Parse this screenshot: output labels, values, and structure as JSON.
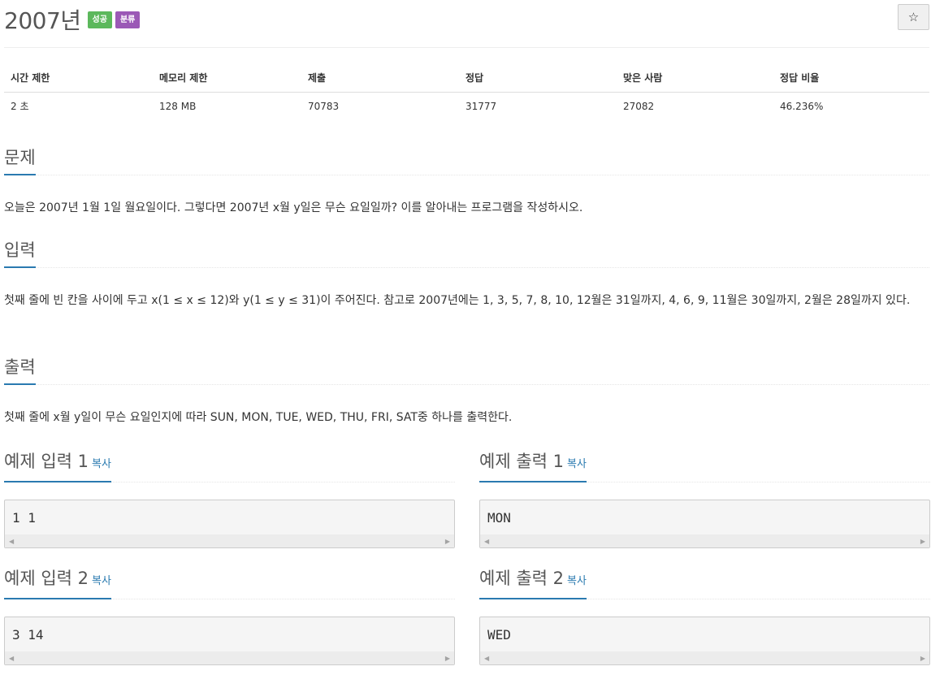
{
  "problem": {
    "title": "2007년",
    "badges": {
      "success": "성공",
      "category": "분류"
    },
    "star_icon": "☆"
  },
  "info_table": {
    "headers": [
      "시간 제한",
      "메모리 제한",
      "제출",
      "정답",
      "맞은 사람",
      "정답 비율"
    ],
    "values": [
      "2 초",
      "128 MB",
      "70783",
      "31777",
      "27082",
      "46.236%"
    ]
  },
  "sections": {
    "problem_heading": "문제",
    "problem_text": "오늘은 2007년 1월 1일 월요일이다. 그렇다면 2007년 x월 y일은 무슨 요일일까? 이를 알아내는 프로그램을 작성하시오.",
    "input_heading": "입력",
    "input_text": "첫째 줄에 빈 칸을 사이에 두고 x(1 ≤ x ≤ 12)와 y(1 ≤ y ≤ 31)이 주어진다. 참고로 2007년에는 1, 3, 5, 7, 8, 10, 12월은 31일까지, 4, 6, 9, 11월은 30일까지, 2월은 28일까지 있다.",
    "output_heading": "출력",
    "output_text": "첫째 줄에 x월 y일이 무슨 요일인지에 따라 SUN, MON, TUE, WED, THU, FRI, SAT중 하나를 출력한다."
  },
  "examples": {
    "copy_label": "복사",
    "input1_heading": "예제 입력 1",
    "input1_value": "1 1",
    "output1_heading": "예제 출력 1",
    "output1_value": "MON",
    "input2_heading": "예제 입력 2",
    "input2_value": "3 14",
    "output2_heading": "예제 출력 2",
    "output2_value": "WED"
  },
  "colors": {
    "accent": "#2a7ab0",
    "badge_success": "#5cb85c",
    "badge_category": "#9b59b6"
  }
}
